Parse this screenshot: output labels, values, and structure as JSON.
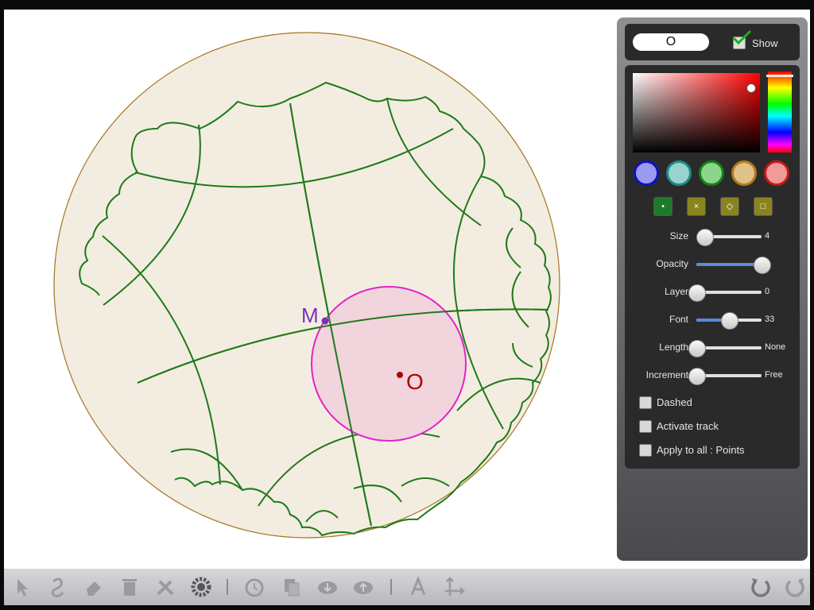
{
  "canvas": {
    "points": [
      {
        "label": "M",
        "color": "#7b2fbe"
      },
      {
        "label": "O",
        "color": "#b00000"
      }
    ],
    "colors": {
      "disk_fill": "#f3ede1",
      "disk_stroke": "#a5741e",
      "lines": "#1f7a1a",
      "circle_stroke": "#e024c8",
      "circle_fill": "#f2d4dd"
    }
  },
  "panel": {
    "name_value": "O",
    "show_label": "Show",
    "show_checked": true,
    "swatches": [
      {
        "fill": "#9a9af0",
        "ring": "#1010c8"
      },
      {
        "fill": "#9ad2d0",
        "ring": "#1c8a8a"
      },
      {
        "fill": "#8ad68a",
        "ring": "#168016"
      },
      {
        "fill": "#e2c08a",
        "ring": "#b07a1c"
      },
      {
        "fill": "#f09a9a",
        "ring": "#c81818"
      }
    ],
    "style_buttons": [
      {
        "glyph": "•",
        "icon": "dot-style-icon"
      },
      {
        "glyph": "×",
        "icon": "cross-style-icon"
      },
      {
        "glyph": "◇",
        "icon": "diamond-style-icon"
      },
      {
        "glyph": "□",
        "icon": "square-style-icon"
      }
    ],
    "sliders": [
      {
        "label": "Size",
        "value": "4",
        "fraction": 0.12,
        "filled": false
      },
      {
        "label": "Opacity",
        "value": "1",
        "fraction": 1.0,
        "filled": true
      },
      {
        "label": "Layer",
        "value": "0",
        "fraction": 0.0,
        "filled": false
      },
      {
        "label": "Font",
        "value": "33",
        "fraction": 0.5,
        "filled": true
      },
      {
        "label": "Length",
        "value": "None",
        "fraction": 0.0,
        "filled": false
      },
      {
        "label": "Increment",
        "value": "Free",
        "fraction": 0.0,
        "filled": false
      }
    ],
    "checkboxes": [
      {
        "label": "Dashed",
        "checked": false
      },
      {
        "label": "Activate track",
        "checked": false
      },
      {
        "label": "Apply to all : Points",
        "checked": false
      }
    ]
  },
  "toolbar": {
    "left_tools": [
      "pointer-icon",
      "freehand-icon",
      "eraser-icon",
      "trash-icon",
      "tools-icon",
      "gear-icon"
    ],
    "middle_tools": [
      "history-icon",
      "copy-icon",
      "download-icon",
      "upload-icon"
    ],
    "right_group": [
      "text-icon",
      "axes-icon"
    ],
    "undo": "undo-icon",
    "redo": "redo-icon"
  }
}
